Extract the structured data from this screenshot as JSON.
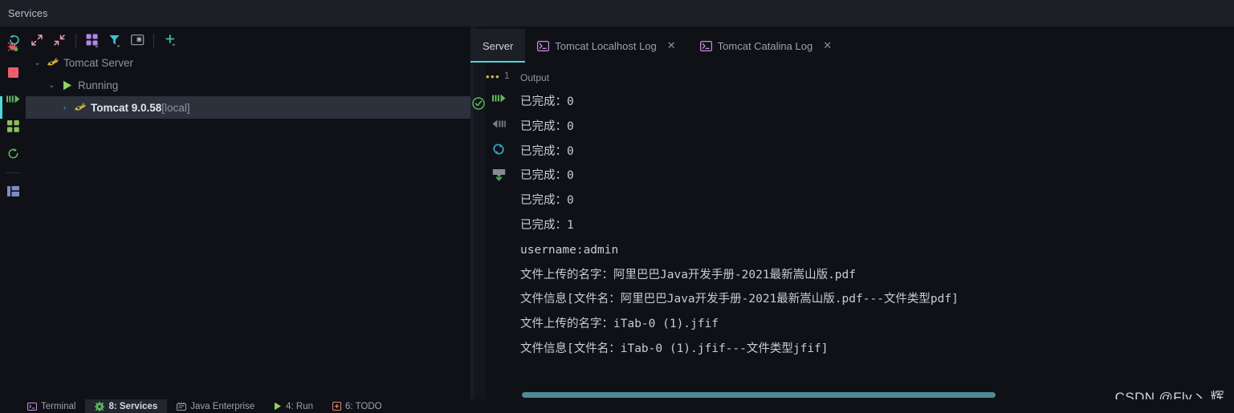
{
  "window": {
    "title": "Services"
  },
  "gutter": {
    "items": [
      {
        "name": "debug-icon",
        "label": "Debug"
      },
      {
        "name": "stop-icon",
        "label": "Stop"
      },
      {
        "name": "resume-program-icon",
        "label": "Resume Program"
      },
      {
        "name": "services-grid-icon",
        "label": "Services"
      },
      {
        "name": "rerun-icon",
        "label": "Rerun"
      },
      {
        "name": "dashboard-icon",
        "label": "Dashboard"
      }
    ]
  },
  "toolbar": {
    "buttons": [
      {
        "name": "refresh-button",
        "label": "Refresh"
      },
      {
        "name": "expand-all-button",
        "label": "Expand All"
      },
      {
        "name": "collapse-all-button",
        "label": "Collapse All"
      },
      {
        "name": "group-by-button",
        "label": "Group By"
      },
      {
        "name": "filter-button",
        "label": "Filter"
      },
      {
        "name": "open-in-new-window-button",
        "label": "Show in New Window"
      },
      {
        "name": "add-service-button",
        "label": "Add"
      }
    ]
  },
  "tree": {
    "nodes": [
      {
        "name": "tomcat-server",
        "label": "Tomcat Server",
        "chevron": "⌄",
        "selected": false
      },
      {
        "name": "running-group",
        "label": "Running",
        "chevron": "⌄",
        "selected": false
      },
      {
        "name": "tomcat-instance",
        "label": "Tomcat 9.0.58",
        "suffix": " [local]",
        "chevron": "›",
        "selected": true
      }
    ]
  },
  "tabs": {
    "items": [
      {
        "name": "tab-server",
        "label": "Server",
        "active": true,
        "closable": false,
        "icon": false
      },
      {
        "name": "tab-tomcat-localhost-log",
        "label": "Tomcat Localhost Log",
        "active": false,
        "closable": true,
        "icon": true
      },
      {
        "name": "tab-tomcat-catalina-log",
        "label": "Tomcat Catalina Log",
        "active": false,
        "closable": true,
        "icon": true
      }
    ],
    "close_glyph": "✕"
  },
  "console_toolbar": {
    "buttons": [
      {
        "name": "resume-icon",
        "label": "Resume"
      },
      {
        "name": "step-back-icon",
        "label": "Step Back"
      },
      {
        "name": "rerun-icon",
        "label": "Rerun"
      },
      {
        "name": "scroll-to-end-icon",
        "label": "Scroll to End"
      }
    ]
  },
  "badge": {
    "dots": "•••",
    "count": "1"
  },
  "output": {
    "label": "Output",
    "lines": [
      "已完成：0",
      "已完成：0",
      "已完成：0",
      "已完成：0",
      "已完成：0",
      "已完成：1",
      "username:admin",
      "文件上传的名字：阿里巴巴Java开发手册-2021最新嵩山版.pdf",
      "文件信息[文件名：阿里巴巴Java开发手册-2021最新嵩山版.pdf---文件类型pdf]",
      "文件上传的名字：iTab-0 (1).jfif",
      "文件信息[文件名：iTab-0 (1).jfif---文件类型jfif]"
    ]
  },
  "statusbar": {
    "items": [
      {
        "name": "status-terminal",
        "label": "Terminal",
        "active": false
      },
      {
        "name": "status-services",
        "label": "8: Services",
        "active": true
      },
      {
        "name": "status-java-enterprise",
        "label": "Java Enterprise",
        "active": false
      },
      {
        "name": "status-run",
        "label": "4: Run",
        "active": false
      },
      {
        "name": "status-todo",
        "label": "6: TODO",
        "active": false
      }
    ]
  },
  "watermark": {
    "text": "CSDN @Fly丶 辉"
  },
  "colors": {
    "accent_cyan": "#4fd6d6",
    "selection_bg": "#2c313c",
    "panel_bg": "#0f1117",
    "titlebar_bg": "#1c1f26",
    "scrollbar_thumb": "#4e8a92",
    "text_primary": "#c7ccd6",
    "text_dim": "#8d93a1"
  }
}
